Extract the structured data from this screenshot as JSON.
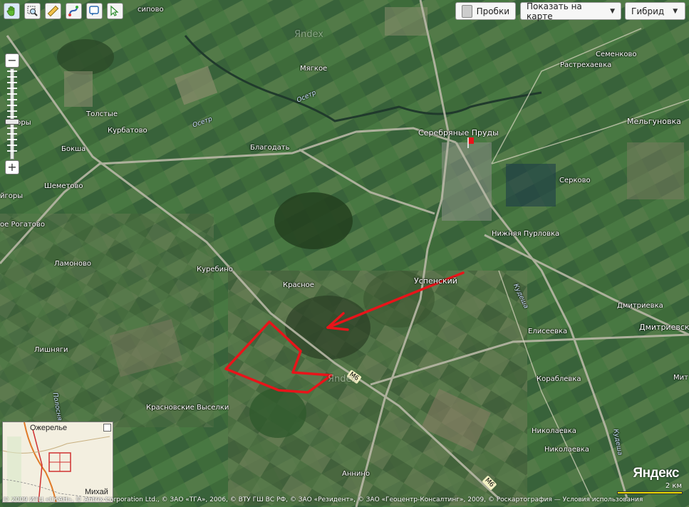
{
  "toolbar": {
    "tools": [
      {
        "name": "hand-tool",
        "icon": "hand-icon"
      },
      {
        "name": "magnifier-tool",
        "icon": "magnifier-icon"
      },
      {
        "name": "ruler-tool",
        "icon": "ruler-icon"
      },
      {
        "name": "route-tool",
        "icon": "route-icon"
      },
      {
        "name": "placemark-tool",
        "icon": "placemark-icon"
      },
      {
        "name": "pointer-tool",
        "icon": "pointer-icon"
      }
    ]
  },
  "controls": {
    "traffic_label": "Пробки",
    "show_on_map_label": "Показать на карте",
    "map_type_label": "Гибрид"
  },
  "labels": {
    "sipovo": "сипово",
    "myagkoe": "Мягкое",
    "tolstye": "Толстые",
    "kurbatovo": "Курбатово",
    "gory": "горы",
    "boksha": "Бокша",
    "blagodat": "Благодать",
    "serebryanye_prudy": "Серебряные Пруды",
    "semenkovo": "Семенково",
    "rastrekhaevka": "Растрехаевка",
    "melgunovka": "Мельгуновка",
    "shemetovo": "Шеметово",
    "gory2": "йгоры",
    "rogatovo": "ое Рогатово",
    "serkovo": "Серково",
    "nizhnyaya_purlovka": "Нижняя Пурловка",
    "lamonovo": "Ламоново",
    "kurebino": "Куребино",
    "krasnoe": "Красное",
    "uspensky": "Успенский",
    "dmitrievka": "Дмитриевка",
    "eliseevka": "Елисеевка",
    "dmitrievsk": "Дмитриевск",
    "lishnyagi": "Лишняги",
    "korablevka": "Кораблевка",
    "krasnovskie_vyselki": "Красновские Выселки",
    "nikolaevka": "Николаевка",
    "nikolaevka2": "Николаевка",
    "annino": "Аннино",
    "mit": "Мит",
    "la": "ла",
    "osetr_1": "Осетр",
    "osetr_2": "Осетр",
    "kudesha_1": "Кудеша",
    "kudesha_2": "Кудеша",
    "polosnya": "Полосня",
    "m6_1": "М6",
    "m6_2": "М6",
    "yandex_watermark_1": "Яndex",
    "yandex_watermark_2": "Яndex"
  },
  "minimap": {
    "ozherelye": "Ожерелье",
    "mikhay": "Михай"
  },
  "logo": "Яндекс",
  "scale": {
    "label": "2 км"
  },
  "copyright": "© 2009 ИТЦ «СКАН», © Antrix Corporation Ltd., © ЗАО «ТГА», 2006, © ВТУ ГШ ВС РФ, © ЗАО «Резидент», © ЗАО «Геоцентр-Консалтинг», 2009, © Роскартография — ",
  "terms_link": "Условия использования",
  "colors": {
    "outline": "#e8141a",
    "arrow": "#e8141a",
    "scale_bar": "#e8d800"
  }
}
